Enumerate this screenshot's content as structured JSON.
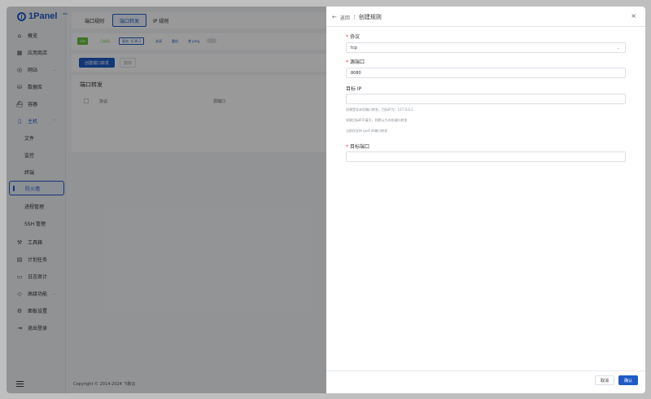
{
  "app": {
    "name": "1Panel",
    "version": "PRO"
  },
  "sidebar": {
    "items": [
      {
        "label": "概览",
        "icon": "home-icon"
      },
      {
        "label": "应用商店",
        "icon": "grid-icon"
      },
      {
        "label": "网站",
        "icon": "globe-icon"
      },
      {
        "label": "数据库",
        "icon": "database-icon"
      },
      {
        "label": "容器",
        "icon": "ship-icon"
      },
      {
        "label": "主机",
        "icon": "host-icon"
      },
      {
        "label": "文件"
      },
      {
        "label": "监控"
      },
      {
        "label": "终端"
      },
      {
        "label": "防火墙"
      },
      {
        "label": "进程管理"
      },
      {
        "label": "SSH 管理"
      },
      {
        "label": "工具箱",
        "icon": "toolbox-icon"
      },
      {
        "label": "计划任务",
        "icon": "calendar-icon"
      },
      {
        "label": "日志审计",
        "icon": "log-icon"
      },
      {
        "label": "高级功能",
        "icon": "diamond-icon"
      },
      {
        "label": "面板设置",
        "icon": "settings-icon"
      },
      {
        "label": "退出登录",
        "icon": "logout-icon"
      }
    ]
  },
  "main": {
    "tabs": [
      "端口规则",
      "端口转发",
      "IP 规则"
    ],
    "status": {
      "name": "ufw",
      "state": "已启动",
      "version": "版本: 0.36.1",
      "stop": "关闭",
      "restart": "重启",
      "ping": "禁 ping"
    },
    "toolbar": {
      "create": "创建端口转发",
      "delete": "删除"
    },
    "section_title": "端口转发",
    "columns": [
      "协议",
      "源端口"
    ],
    "footer": "Copyright © 2014-2024 飞致云"
  },
  "drawer": {
    "back": "返回",
    "title": "创建规则",
    "protocol_label": "协议",
    "protocol_value": "tcp",
    "source_port_label": "源端口",
    "source_port_value": "8080",
    "target_ip_label": "目标 IP",
    "target_ip_value": "",
    "hints": [
      "如果是非本机端口转发，目标IP为：127.0.0.1",
      "如果目标IP不填写，则默认为本机端口转发",
      "当前仅支持 ipv4 的端口转发"
    ],
    "target_port_label": "目标端口",
    "target_port_value": "",
    "cancel": "取消",
    "confirm": "确认"
  },
  "colors": {
    "primary": "#1e5bc6",
    "required": "#e53935",
    "ufw_badge": "#67c23a"
  }
}
